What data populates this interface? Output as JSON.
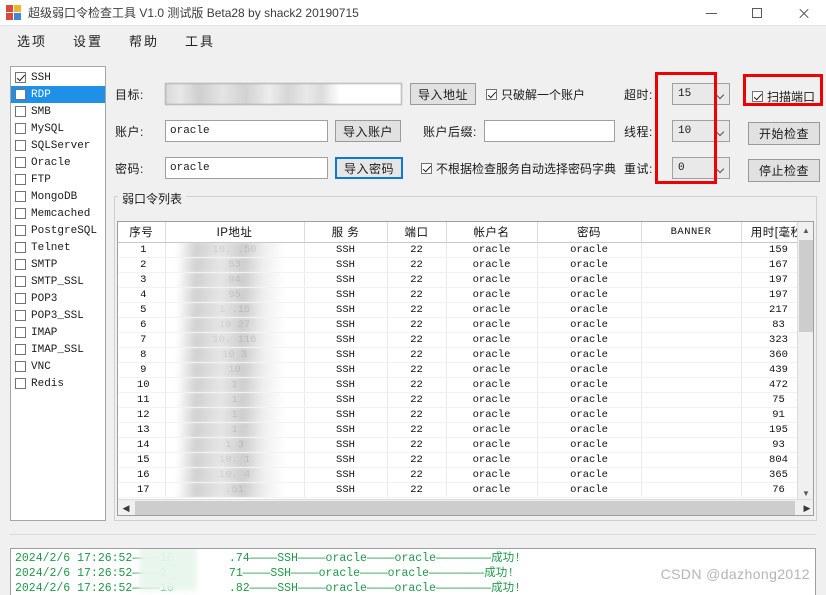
{
  "window": {
    "title": "超级弱口令检查工具 V1.0 测试版 Beta28 by shack2 20190715",
    "minimize_label": "最小化",
    "maximize_label": "最大化",
    "close_label": "关闭"
  },
  "menu": {
    "items": [
      {
        "label": "选项"
      },
      {
        "label": "设置"
      },
      {
        "label": "帮助"
      },
      {
        "label": "工具"
      }
    ]
  },
  "protocols": [
    {
      "label": "SSH",
      "checked": true,
      "selected": false
    },
    {
      "label": "RDP",
      "checked": false,
      "selected": true
    },
    {
      "label": "SMB",
      "checked": false,
      "selected": false
    },
    {
      "label": "MySQL",
      "checked": false,
      "selected": false
    },
    {
      "label": "SQLServer",
      "checked": false,
      "selected": false
    },
    {
      "label": "Oracle",
      "checked": false,
      "selected": false
    },
    {
      "label": "FTP",
      "checked": false,
      "selected": false
    },
    {
      "label": "MongoDB",
      "checked": false,
      "selected": false
    },
    {
      "label": "Memcached",
      "checked": false,
      "selected": false
    },
    {
      "label": "PostgreSQL",
      "checked": false,
      "selected": false
    },
    {
      "label": "Telnet",
      "checked": false,
      "selected": false
    },
    {
      "label": "SMTP",
      "checked": false,
      "selected": false
    },
    {
      "label": "SMTP_SSL",
      "checked": false,
      "selected": false
    },
    {
      "label": "POP3",
      "checked": false,
      "selected": false
    },
    {
      "label": "POP3_SSL",
      "checked": false,
      "selected": false
    },
    {
      "label": "IMAP",
      "checked": false,
      "selected": false
    },
    {
      "label": "IMAP_SSL",
      "checked": false,
      "selected": false
    },
    {
      "label": "VNC",
      "checked": false,
      "selected": false
    },
    {
      "label": "Redis",
      "checked": false,
      "selected": false
    }
  ],
  "form": {
    "target_label": "目标:",
    "target_value": "",
    "import_address_button": "导入地址",
    "only_one_account_label": "只破解一个账户",
    "only_one_account_checked": true,
    "account_label": "账户:",
    "account_value": "oracle",
    "import_account_button": "导入账户",
    "account_suffix_label": "账户后缀:",
    "account_suffix_value": "",
    "password_label": "密码:",
    "password_value": "oracle",
    "import_password_button": "导入密码",
    "auto_dict_label": "不根据检查服务自动选择密码字典",
    "auto_dict_checked": true
  },
  "settings": {
    "timeout_label": "超时:",
    "timeout_value": "15",
    "threads_label": "线程:",
    "threads_value": "10",
    "retry_label": "重试:",
    "retry_value": "0",
    "scan_port_label": "扫描端口",
    "scan_port_checked": true,
    "start_button": "开始检查",
    "stop_button": "停止检查",
    "highlight_color": "#f00000"
  },
  "results": {
    "group_title": "弱口令列表",
    "columns": [
      "序号",
      "IP地址",
      "服 务",
      "端口",
      "帐户名",
      "密码",
      "BANNER",
      "用时[毫秒]"
    ],
    "rows": [
      {
        "idx": "1",
        "ip": "10.       .50",
        "service": "SSH",
        "port": "22",
        "account": "oracle",
        "password": "oracle",
        "banner": "",
        "elapsed": "159"
      },
      {
        "idx": "2",
        "ip": "            53",
        "service": "SSH",
        "port": "22",
        "account": "oracle",
        "password": "oracle",
        "banner": "",
        "elapsed": "167"
      },
      {
        "idx": "3",
        "ip": "            94",
        "service": "SSH",
        "port": "22",
        "account": "oracle",
        "password": "oracle",
        "banner": "",
        "elapsed": "197"
      },
      {
        "idx": "4",
        "ip": "            95",
        "service": "SSH",
        "port": "22",
        "account": "oracle",
        "password": "oracle",
        "banner": "",
        "elapsed": "197"
      },
      {
        "idx": "5",
        "ip": "1        .15",
        "service": "SSH",
        "port": "22",
        "account": "oracle",
        "password": "oracle",
        "banner": "",
        "elapsed": "217"
      },
      {
        "idx": "6",
        "ip": "10      27",
        "service": "SSH",
        "port": "22",
        "account": "oracle",
        "password": "oracle",
        "banner": "",
        "elapsed": "83"
      },
      {
        "idx": "7",
        "ip": "10.    116",
        "service": "SSH",
        "port": "22",
        "account": "oracle",
        "password": "oracle",
        "banner": "",
        "elapsed": "323"
      },
      {
        "idx": "8",
        "ip": "10        3",
        "service": "SSH",
        "port": "22",
        "account": "oracle",
        "password": "oracle",
        "banner": "",
        "elapsed": "360"
      },
      {
        "idx": "9",
        "ip": "10          ",
        "service": "SSH",
        "port": "22",
        "account": "oracle",
        "password": "oracle",
        "banner": "",
        "elapsed": "439"
      },
      {
        "idx": "10",
        "ip": "1           ",
        "service": "SSH",
        "port": "22",
        "account": "oracle",
        "password": "oracle",
        "banner": "",
        "elapsed": "472"
      },
      {
        "idx": "11",
        "ip": "1           ",
        "service": "SSH",
        "port": "22",
        "account": "oracle",
        "password": "oracle",
        "banner": "",
        "elapsed": "75"
      },
      {
        "idx": "12",
        "ip": "1           ",
        "service": "SSH",
        "port": "22",
        "account": "oracle",
        "password": "oracle",
        "banner": "",
        "elapsed": "91"
      },
      {
        "idx": "13",
        "ip": "1           ",
        "service": "SSH",
        "port": "22",
        "account": "oracle",
        "password": "oracle",
        "banner": "",
        "elapsed": "195"
      },
      {
        "idx": "14",
        "ip": "1        3",
        "service": "SSH",
        "port": "22",
        "account": "oracle",
        "password": "oracle",
        "banner": "",
        "elapsed": "93"
      },
      {
        "idx": "15",
        "ip": "10.      1",
        "service": "SSH",
        "port": "22",
        "account": "oracle",
        "password": "oracle",
        "banner": "",
        "elapsed": "804"
      },
      {
        "idx": "16",
        "ip": "10.    4",
        "service": "SSH",
        "port": "22",
        "account": "oracle",
        "password": "oracle",
        "banner": "",
        "elapsed": "365"
      },
      {
        "idx": "17",
        "ip": "      .51",
        "service": "SSH",
        "port": "22",
        "account": "oracle",
        "password": "oracle",
        "banner": "",
        "elapsed": "76"
      }
    ]
  },
  "log": {
    "lines": [
      "2024/2/6 17:26:52————10        .74————SSH————oracle————oracle————————成功!",
      "2024/2/6 17:26:52————2         71————SSH————oracle————oracle————————成功!",
      "2024/2/6 17:26:52————10        .82————SSH————oracle————oracle————————成功!"
    ],
    "color": "#1f9a4a"
  },
  "watermark": "CSDN @dazhong2012"
}
